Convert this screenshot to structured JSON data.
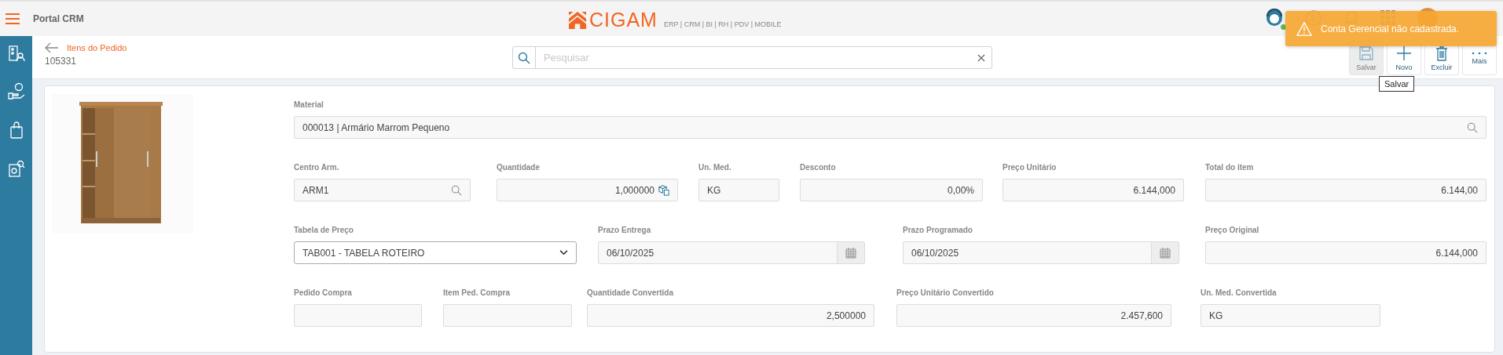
{
  "topbar": {
    "app_title": "Portal CRM",
    "logo": {
      "brand": "CIGAM",
      "tagline": "ERP | CRM | BI | RH | PDV | MOBILE"
    },
    "support_online": true
  },
  "header": {
    "breadcrumb": "Itens do Pedido",
    "order_number": "105331"
  },
  "search": {
    "placeholder": "Pesquisar"
  },
  "toolbar": [
    {
      "kind": "save",
      "label": "Salvar",
      "disabled": true
    },
    {
      "kind": "new",
      "label": "Novo",
      "disabled": false
    },
    {
      "kind": "delete",
      "label": "Excluir",
      "disabled": false
    },
    {
      "kind": "more",
      "label": "Mais",
      "disabled": false
    }
  ],
  "tooltip": "Salvar",
  "toast": {
    "message": "Conta Gerencial não cadastrada."
  },
  "form": {
    "fields": [
      {
        "label": "Material",
        "kind": "lookup",
        "value": "000013 | Armário Marrom Pequeno"
      },
      {
        "label": "Centro Arm.",
        "kind": "lookup",
        "value": "ARM1"
      },
      {
        "label": "Quantidade",
        "kind": "quantity",
        "value": "1,000000"
      },
      {
        "label": "Un. Med.",
        "kind": "text",
        "value": "KG"
      },
      {
        "label": "Desconto",
        "kind": "number",
        "value": "0,00%"
      },
      {
        "label": "Preço Unitário",
        "kind": "number",
        "value": "6.144,000"
      },
      {
        "label": "Total do item",
        "kind": "number",
        "value": "6.144,00"
      },
      {
        "label": "Tabela de Preço",
        "kind": "select",
        "value": "TAB001 - TABELA ROTEIRO"
      },
      {
        "label": "Prazo Entrega",
        "kind": "date",
        "value": "06/10/2025"
      },
      {
        "label": "Prazo Programado",
        "kind": "date",
        "value": "06/10/2025"
      },
      {
        "label": "Preço Original",
        "kind": "number",
        "value": "6.144,000"
      },
      {
        "label": "Pedido Compra",
        "kind": "text"
      },
      {
        "label": "Item Ped. Compra",
        "kind": "text"
      },
      {
        "label": "Quantidade Convertida",
        "kind": "number",
        "value": "2,500000"
      },
      {
        "label": "Preço Unitário Convertido",
        "kind": "number",
        "value": "2.457,600"
      },
      {
        "label": "Un. Med. Convertida",
        "kind": "text",
        "value": "KG"
      }
    ]
  }
}
